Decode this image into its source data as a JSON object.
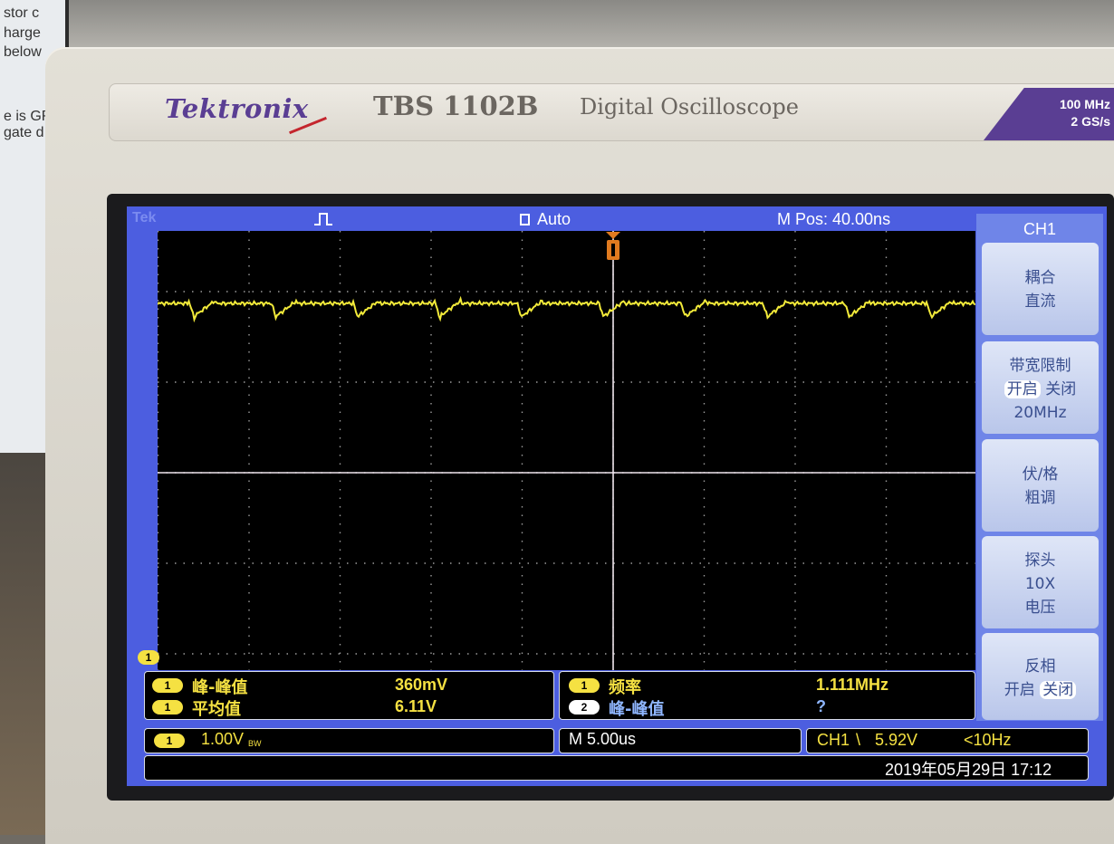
{
  "background": {
    "monitor_text": [
      "stor c",
      "harge",
      "below",
      "e is GR",
      "gate d"
    ]
  },
  "scope": {
    "brand": "Tektronix",
    "model": "TBS 1102B",
    "description": "Digital Oscilloscope",
    "spec_bandwidth": "100 MHz",
    "spec_sample_rate": "2 GS/s"
  },
  "status_bar": {
    "logo": "Tek",
    "run_mode": "Auto",
    "m_pos": "M Pos: 40.00ns"
  },
  "menu": {
    "title": "CH1",
    "items": [
      {
        "line1": "耦合",
        "line2": "直流"
      },
      {
        "line1": "带宽限制",
        "opt_on": "开启",
        "opt_off": "关闭",
        "line3": "20MHz"
      },
      {
        "line1": "伏/格",
        "line2": "粗调"
      },
      {
        "line1": "探头",
        "line2": "10X",
        "line3": "电压"
      },
      {
        "line1": "反相",
        "opt_on": "开启",
        "opt_off": "关闭"
      }
    ]
  },
  "measurements": {
    "left": [
      {
        "channel": "1",
        "label": "峰-峰值",
        "value": "360mV"
      },
      {
        "channel": "1",
        "label": "平均值",
        "value": "6.11V"
      }
    ],
    "right": [
      {
        "channel": "1",
        "label": "频率",
        "value": "1.111MHz"
      },
      {
        "channel": "2",
        "label": "峰-峰值",
        "value": "?"
      }
    ]
  },
  "settings": {
    "ch1_marker": "1",
    "ch1_scale": "1.00V",
    "ch1_bw_suffix": "BW",
    "timebase": "M 5.00us",
    "trigger_channel": "CH1",
    "trigger_slope_symbol": "\\",
    "trigger_level": "5.92V",
    "trigger_freq": "<10Hz"
  },
  "datetime": "2019年05月29日 17:12",
  "waveform": {
    "color": "#f2ea3a",
    "description_units": "divisions",
    "baseline_div": 0.2,
    "ripple_period_div": 0.9,
    "dip_depth_div": 0.2
  }
}
